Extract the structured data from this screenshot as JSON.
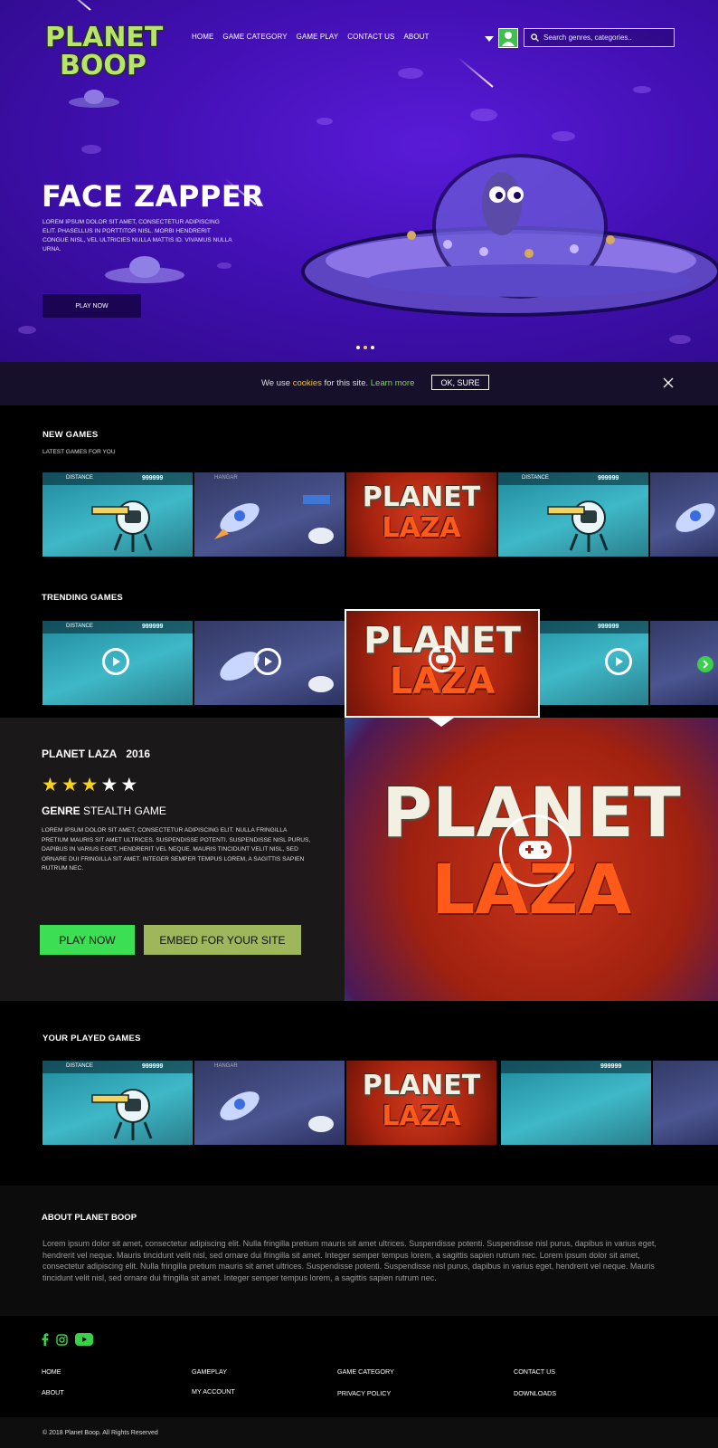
{
  "brand": {
    "logo_line1": "PLANET",
    "logo_line2": "BOOP"
  },
  "nav": {
    "items": [
      "HOME",
      "GAME CATEGORY",
      "GAME PLAY",
      "CONTACT US",
      "ABOUT"
    ]
  },
  "search": {
    "placeholder": "Search genres, categories.."
  },
  "hero": {
    "title": "FACE ZAPPER",
    "description": "LOREM IPSUM DOLOR SIT AMET, CONSECTETUR ADIPISCING ELIT. PHASELLUS IN PORTTITOR NISL. MORBI HENDRERIT CONGUE NISL, VEL ULTRICIES NULLA MATTIS ID. VIVAMUS NULLA URNA.",
    "cta": "PLAY NOW",
    "slide_count": 3,
    "active_slide": 1
  },
  "cookie": {
    "text_before": "We use ",
    "cookies_link": "cookies",
    "text_middle": " for this site. ",
    "learn_more": "Learn more",
    "ok": "OK, SURE"
  },
  "new_games": {
    "title": "NEW GAMES",
    "subtitle": "LATEST GAMES FOR YOU",
    "hud_score": "999999",
    "hud_label": "DISTANCE",
    "hangar_label": "HANGAR",
    "laza_top": "PLANET",
    "laza_bottom": "LAZA"
  },
  "trending": {
    "title": "TRENDING GAMES"
  },
  "detail": {
    "title": "PLANET LAZA",
    "year": "2016",
    "rating": 3,
    "rating_max": 5,
    "genre_label": "GENRE",
    "genre_value": "STEALTH GAME",
    "description": "LOREM IPSUM DOLOR SIT AMET, CONSECTETUR ADIPISCING ELIT. NULLA FRINGILLA PRETIUM MAURIS SIT AMET ULTRICES. SUSPENDISSE POTENTI. SUSPENDISSE NISL PURUS, DAPIBUS IN VARIUS EGET, HENDRERIT VEL NEQUE. MAURIS TINCIDUNT VELIT NISL, SED ORNARE DUI FRINGILLA SIT AMET. INTEGER SEMPER TEMPUS LOREM, A SAGITTIS SAPIEN RUTRUM NEC.",
    "play_btn": "PLAY NOW",
    "embed_btn": "EMBED FOR YOUR SITE",
    "colors": {
      "play": "#3cdf54",
      "embed": "#9db75a",
      "star": "#f7d21a"
    }
  },
  "played": {
    "title": "YOUR PLAYED GAMES"
  },
  "about": {
    "title": "ABOUT PLANET BOOP",
    "text": "Lorem ipsum dolor sit amet, consectetur adipiscing elit. Nulla fringilla pretium mauris sit amet ultrices. Suspendisse potenti. Suspendisse nisl purus, dapibus in varius eget, hendrerit vel neque. Mauris tincidunt velit nisl, sed ornare dui fringilla sit amet. Integer semper tempus lorem, a sagittis sapien rutrum nec. Lorem ipsum dolor sit amet, consectetur adipiscing elit. Nulla fringilla pretium mauris sit amet ultrices. Suspendisse potenti. Suspendisse nisl purus, dapibus in varius eget, hendrerit vel neque. Mauris tincidunt velit nisl, sed ornare dui fringilla sit amet. Integer semper tempus lorem, a sagittis sapien rutrum nec."
  },
  "footer": {
    "social": [
      "facebook-icon",
      "instagram-icon",
      "youtube-icon"
    ],
    "links": {
      "col1": [
        "HOME",
        "ABOUT"
      ],
      "col2": [
        "GAMEPLAY",
        "MY ACCOUNT"
      ],
      "col3": [
        "GAME CATEGORY",
        "PRIVACY POLICY"
      ],
      "col4": [
        "CONTACT US",
        "DOWNLOADS"
      ]
    },
    "copyright": "© 2018 Planet Boop. All Rights Reserved"
  }
}
